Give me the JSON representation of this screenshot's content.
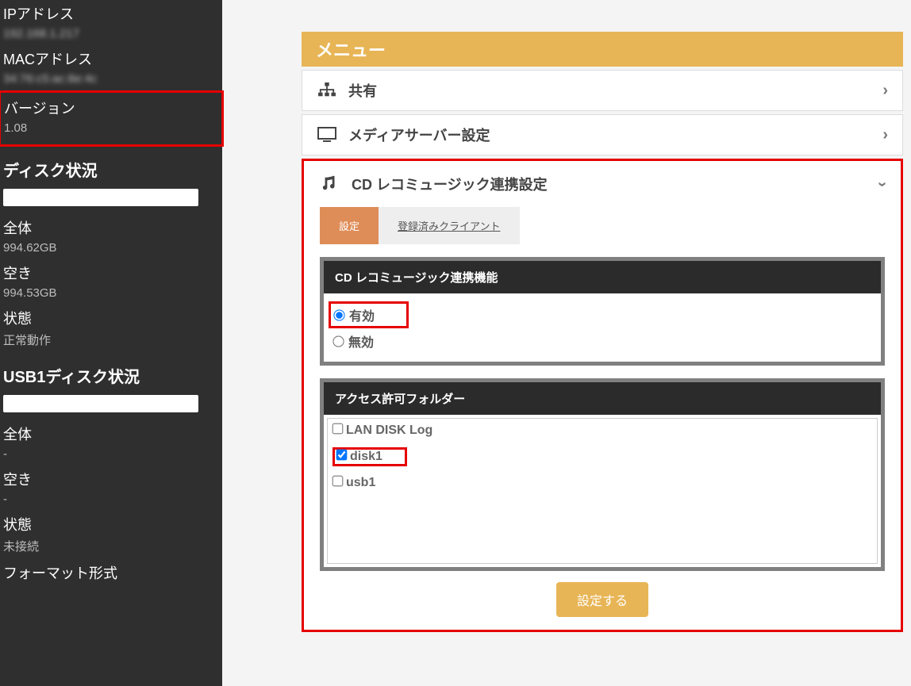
{
  "sidebar": {
    "ip_label": "IPアドレス",
    "ip_value": "192.168.1.217",
    "mac_label": "MACアドレス",
    "mac_value": "34:76:c5:ac:8e:4c",
    "version_label": "バージョン",
    "version_value": "1.08",
    "disk_section": "ディスク状況",
    "total_label": "全体",
    "total_value": "994.62GB",
    "free_label": "空き",
    "free_value": "994.53GB",
    "status_label": "状態",
    "status_value": "正常動作",
    "usb_section": "USB1ディスク状況",
    "usb_total_label": "全体",
    "usb_total_value": "-",
    "usb_free_label": "空き",
    "usb_free_value": "-",
    "usb_status_label": "状態",
    "usb_status_value": "未接続",
    "format_label": "フォーマット形式"
  },
  "menu": {
    "header": "メニュー",
    "share": "共有",
    "media_server": "メディアサーバー設定",
    "cdreco": "CD レコミュージック連携設定"
  },
  "tabs": {
    "settings": "設定",
    "clients": "登録済みクライアント"
  },
  "panel1": {
    "title": "CD レコミュージック連携機能",
    "enable": "有効",
    "disable": "無効"
  },
  "panel2": {
    "title": "アクセス許可フォルダー",
    "folders": [
      "LAN DISK Log",
      "disk1",
      "usb1"
    ]
  },
  "submit": "設定する"
}
